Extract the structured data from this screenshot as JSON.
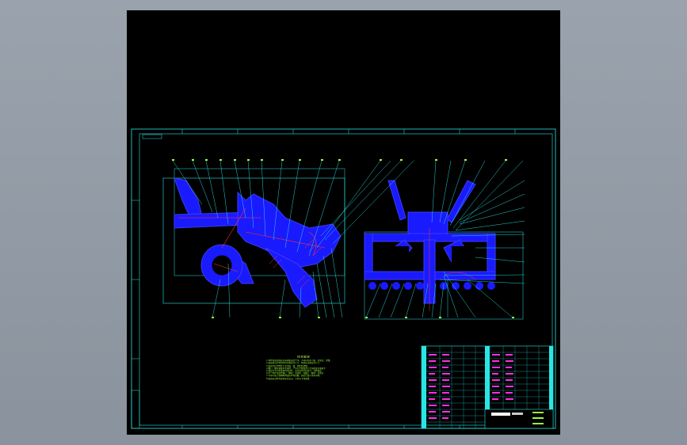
{
  "viewer": {
    "background": "#8f98a2",
    "canvas": "#000000"
  },
  "colors": {
    "frame": "#29e6e6",
    "part": "#1a1aff",
    "leader": "#29e6e6",
    "notes": "#9cff3c",
    "table_text": "#ff2ee6",
    "section": "#ff3030"
  },
  "drawing": {
    "tech_requirements_title": "技术要求",
    "tech_requirements": [
      "1.零件在装配前必须清理和清洗干净，不得有毛刺飞边、氧化皮、锈蚀、",
      "2.装配前应对零部件的主要配合尺寸，特别是过盈配合尺寸",
      "3.装配过程中零件不允许磕、碰、划伤和锈蚀。",
      "4.螺钉、螺栓和螺母紧固时，严禁打击或使用不合适的旋具和扳手",
      "5.规定拧紧力矩要求的紧固件，必须采用力矩扳手，并按规定",
      "6.同一零件用多件螺钉（螺栓）紧固时，各螺钉（螺栓）需交叉",
      "7.平键与轴上键槽两侧面应均匀接触，其配合面不得有间隙。",
      "8.装配后应检查运转是否灵活，不得有卡滞现象。"
    ]
  }
}
